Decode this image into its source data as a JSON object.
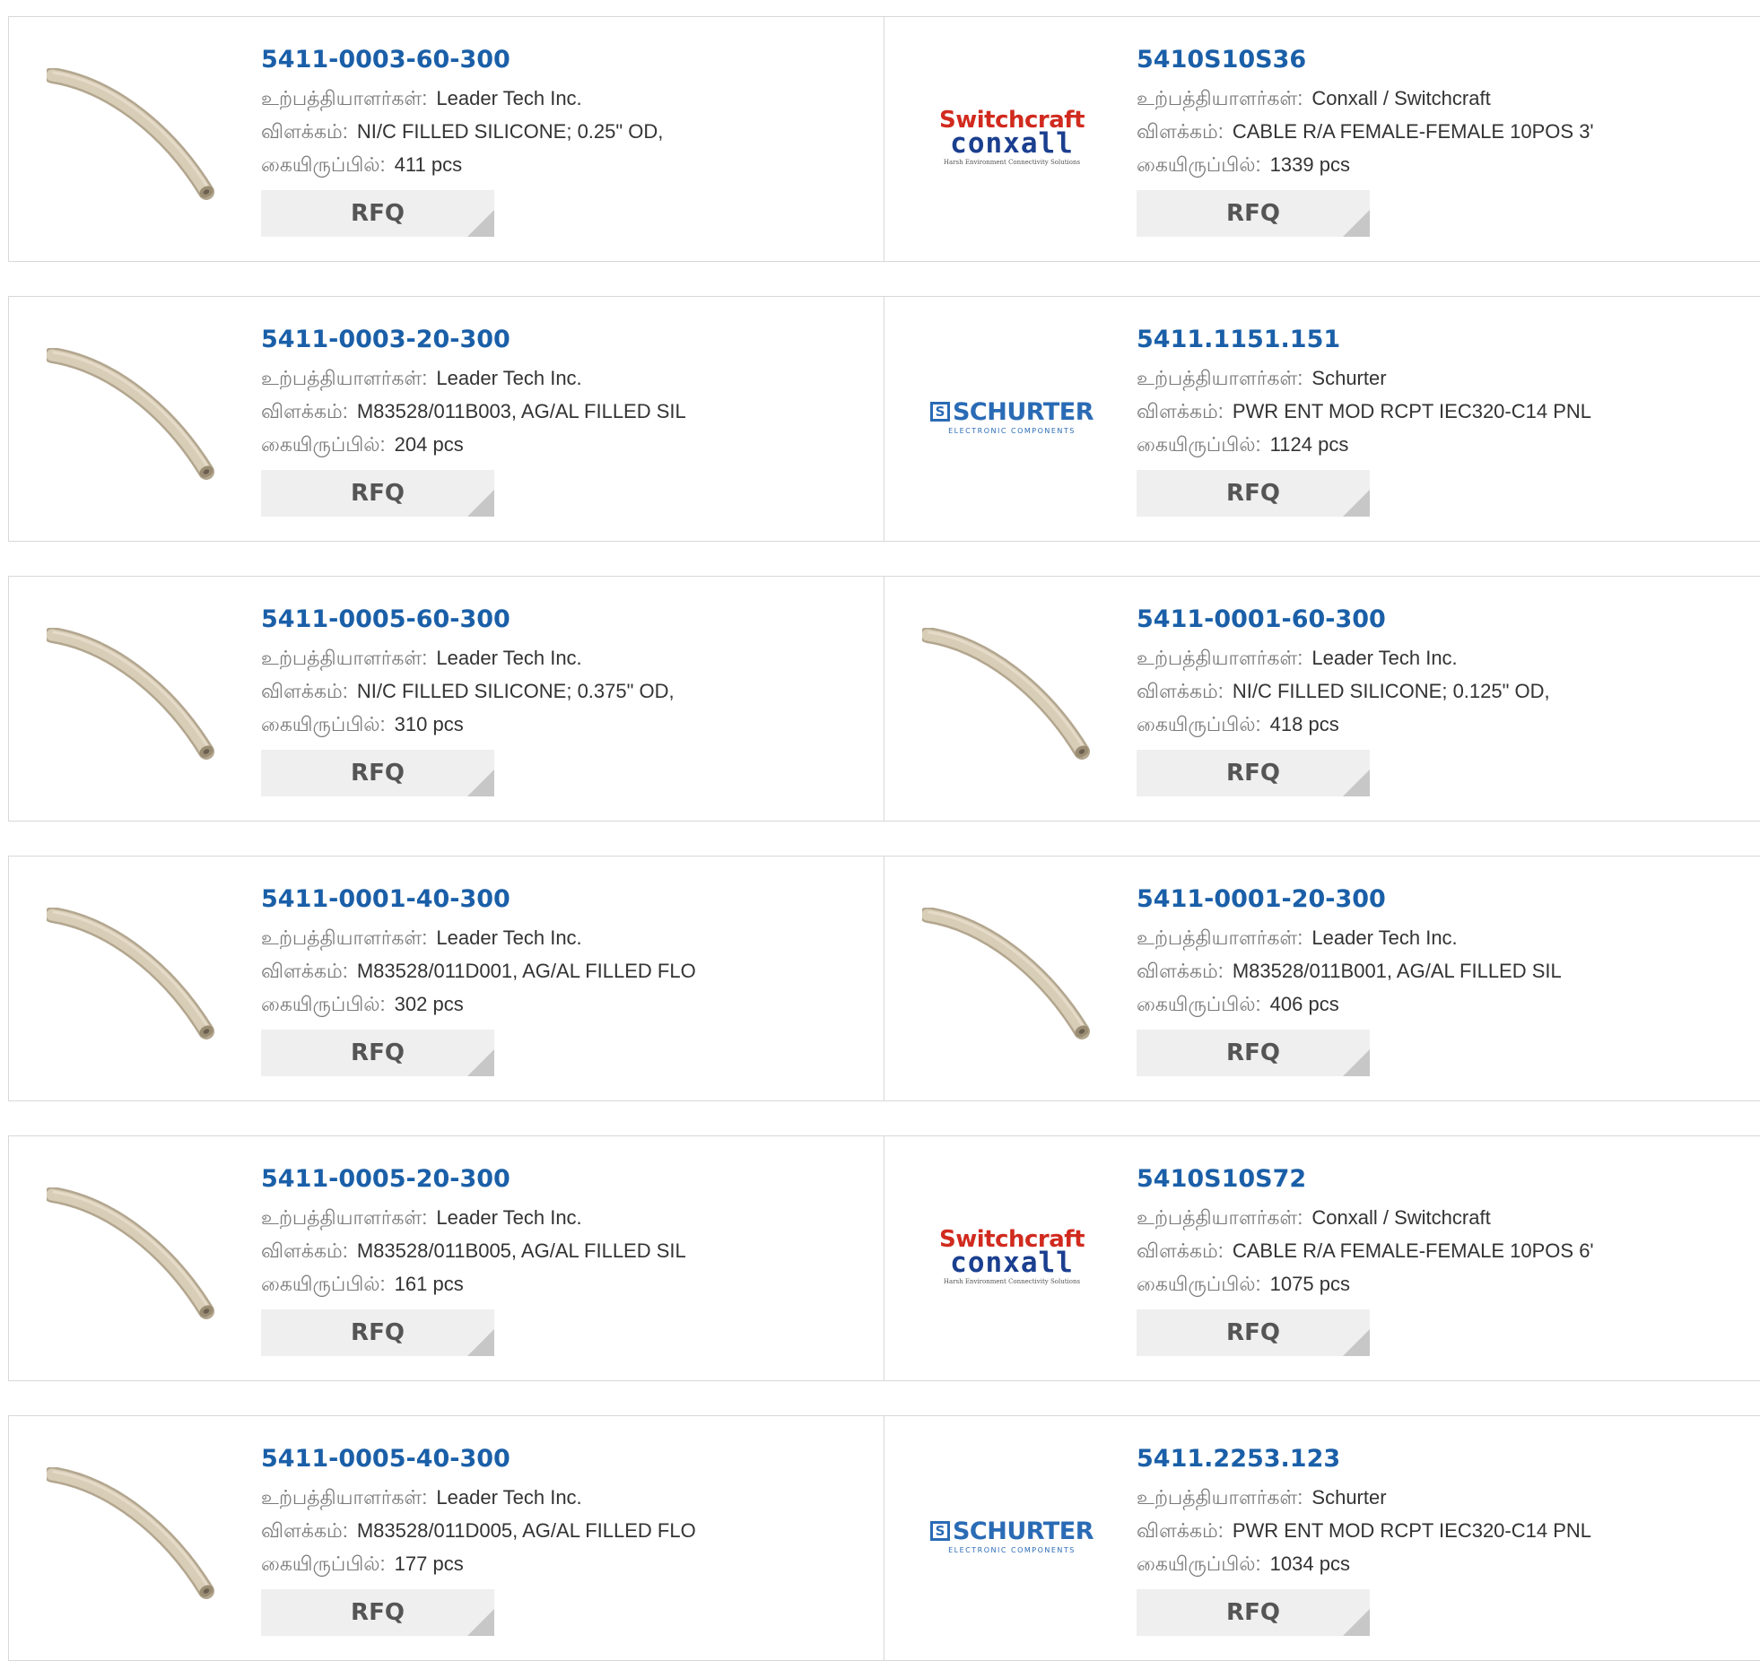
{
  "labels": {
    "manufacturer": "உற்பத்தியாளர்கள்:",
    "description": "விளக்கம்:",
    "stock": "கையிருப்பில்:",
    "rfq": "RFQ"
  },
  "logos": {
    "switchcraft": {
      "line1": "Switchcraft",
      "line2": "conxall",
      "tagline": "Harsh Environment Connectivity Solutions"
    },
    "schurter": {
      "name": "SCHURTER",
      "sub": "ELECTRONIC COMPONENTS"
    }
  },
  "products": [
    [
      {
        "part": "5411-0003-60-300",
        "manufacturer": "Leader Tech Inc.",
        "description": "NI/C FILLED SILICONE; 0.25\" OD,",
        "stock": "411 pcs",
        "image": "tube"
      },
      {
        "part": "5410S10S36",
        "manufacturer": "Conxall / Switchcraft",
        "description": "CABLE R/A FEMALE-FEMALE 10POS 3'",
        "stock": "1339 pcs",
        "image": "switchcraft-logo"
      }
    ],
    [
      {
        "part": "5411-0003-20-300",
        "manufacturer": "Leader Tech Inc.",
        "description": "M83528/011B003, AG/AL FILLED SIL",
        "stock": "204 pcs",
        "image": "tube"
      },
      {
        "part": "5411.1151.151",
        "manufacturer": "Schurter",
        "description": "PWR ENT MOD RCPT IEC320-C14 PNL",
        "stock": "1124 pcs",
        "image": "schurter-logo"
      }
    ],
    [
      {
        "part": "5411-0005-60-300",
        "manufacturer": "Leader Tech Inc.",
        "description": "NI/C FILLED SILICONE; 0.375\" OD,",
        "stock": "310 pcs",
        "image": "tube"
      },
      {
        "part": "5411-0001-60-300",
        "manufacturer": "Leader Tech Inc.",
        "description": "NI/C FILLED SILICONE; 0.125\" OD,",
        "stock": "418 pcs",
        "image": "tube"
      }
    ],
    [
      {
        "part": "5411-0001-40-300",
        "manufacturer": "Leader Tech Inc.",
        "description": "M83528/011D001, AG/AL FILLED FLO",
        "stock": "302 pcs",
        "image": "tube"
      },
      {
        "part": "5411-0001-20-300",
        "manufacturer": "Leader Tech Inc.",
        "description": "M83528/011B001, AG/AL FILLED SIL",
        "stock": "406 pcs",
        "image": "tube"
      }
    ],
    [
      {
        "part": "5411-0005-20-300",
        "manufacturer": "Leader Tech Inc.",
        "description": "M83528/011B005, AG/AL FILLED SIL",
        "stock": "161 pcs",
        "image": "tube"
      },
      {
        "part": "5410S10S72",
        "manufacturer": "Conxall / Switchcraft",
        "description": "CABLE R/A FEMALE-FEMALE 10POS 6'",
        "stock": "1075 pcs",
        "image": "switchcraft-logo"
      }
    ],
    [
      {
        "part": "5411-0005-40-300",
        "manufacturer": "Leader Tech Inc.",
        "description": "M83528/011D005, AG/AL FILLED FLO",
        "stock": "177 pcs",
        "image": "tube"
      },
      {
        "part": "5411.2253.123",
        "manufacturer": "Schurter",
        "description": "PWR ENT MOD RCPT IEC320-C14 PNL",
        "stock": "1034 pcs",
        "image": "schurter-logo"
      }
    ]
  ]
}
